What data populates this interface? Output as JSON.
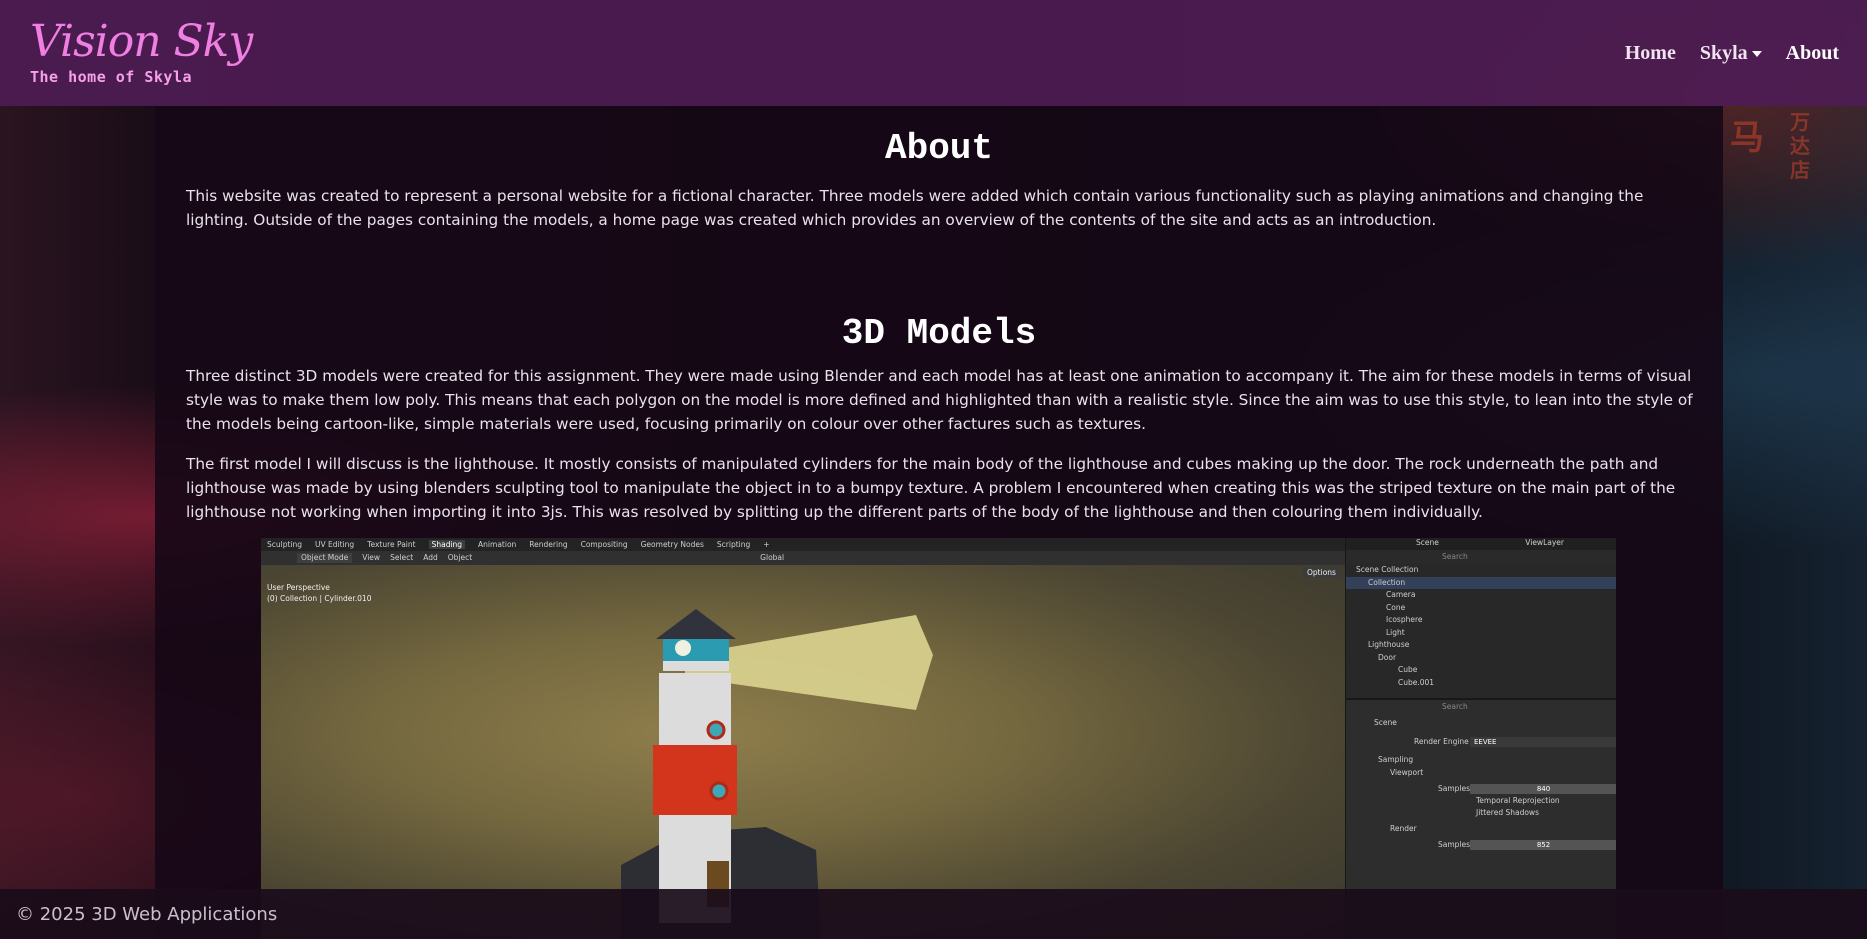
{
  "header": {
    "brand_title": "Vision Sky",
    "brand_subtitle": "The home of Skyla",
    "nav": [
      {
        "label": "Home"
      },
      {
        "label": "Skyla"
      },
      {
        "label": "About"
      }
    ]
  },
  "about": {
    "heading": "About",
    "paragraph": "This website was created to represent a personal website for a fictional character. Three models were added which contain various functionality such as playing animations and changing the lighting. Outside of the pages containing the models, a home page was created which provides an overview of the contents of the site and acts as an introduction."
  },
  "models": {
    "heading": "3D Models",
    "paragraph1": "Three distinct 3D models were created for this assignment. They were made using Blender and each model has at least one animation to accompany it. The aim for these models in terms of visual style was to make them low poly. This means that each polygon on the model is more defined and highlighted than with a realistic style. Since the aim was to use this style, to lean into the style of the models being cartoon-like, simple materials were used, focusing primarily on colour over other factures such as textures.",
    "paragraph2": "The first model I will discuss is the lighthouse. It mostly consists of manipulated cylinders for the main body of the lighthouse and cubes making up the door. The rock underneath the path and lighthouse was made by using blenders sculpting tool to manipulate the object in to a bumpy texture. A problem I encountered when creating this was the striped texture on the main part of the lighthouse not working when importing it into 3js. This was resolved by splitting up the different parts of the body of the lighthouse and then colouring them individually."
  },
  "blender": {
    "workspace_tabs": [
      "Sculpting",
      "UV Editing",
      "Texture Paint",
      "Shading",
      "Animation",
      "Rendering",
      "Compositing",
      "Geometry Nodes",
      "Scripting",
      "+"
    ],
    "active_tab": "Shading",
    "toolbar": [
      "Object Mode",
      "View",
      "Select",
      "Add",
      "Object"
    ],
    "transform": "Global",
    "options": "Options",
    "viewport_label1": "User Perspective",
    "viewport_label2": "(0) Collection | Cylinder.010",
    "outliner_header": {
      "scene": "Scene",
      "view_layer": "ViewLayer",
      "search": "Search"
    },
    "outliner": [
      "Scene Collection",
      "Collection",
      "Camera",
      "Cone",
      "Icosphere",
      "Light",
      "Lighthouse",
      "Door",
      "Cube",
      "Cube.001"
    ],
    "props": {
      "search": "Search",
      "scene": "Scene",
      "render_engine_label": "Render Engine",
      "render_engine": "EEVEE",
      "sampling": "Sampling",
      "viewport": "Viewport",
      "samples_label": "Samples",
      "viewport_samples": "840",
      "temporal": "Temporal Reprojection",
      "jittered": "Jittered Shadows",
      "render": "Render",
      "render_samples": "852"
    }
  },
  "footer": {
    "text": "© 2025 3D Web Applications"
  },
  "colors": {
    "header_bg": "#4e1c54",
    "brand": "#ef7fe0",
    "panel_bg": "#160816"
  }
}
